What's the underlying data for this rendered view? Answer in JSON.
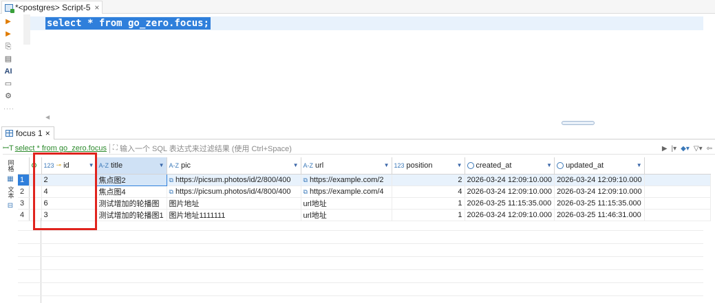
{
  "editor": {
    "tab_title": "*<postgres> Script-5",
    "close": "×",
    "sql": "select * from go_zero.focus;"
  },
  "results": {
    "tab_title": "focus 1",
    "close": "×",
    "filter_query": "select * from go_zero.focus",
    "filter_placeholder": "输入一个 SQL 表达式来过滤结果 (使用 Ctrl+Space)",
    "side_labels": [
      "网格",
      "文本"
    ]
  },
  "columns": [
    {
      "type": "123",
      "name": "id",
      "key": true
    },
    {
      "type": "A-Z",
      "name": "title"
    },
    {
      "type": "A-Z",
      "name": "pic"
    },
    {
      "type": "A-Z",
      "name": "url"
    },
    {
      "type": "123",
      "name": "position"
    },
    {
      "type": "clock",
      "name": "created_at"
    },
    {
      "type": "clock",
      "name": "updated_at"
    }
  ],
  "rows": [
    {
      "rn": "1",
      "id": "2",
      "title": "焦点图2",
      "pic": "https://picsum.photos/id/2/800/400",
      "url": "https://example.com/2",
      "position": "2",
      "created_at": "2026-03-24 12:09:10.000",
      "updated_at": "2026-03-24 12:09:10.000"
    },
    {
      "rn": "2",
      "id": "4",
      "title": "焦点图4",
      "pic": "https://picsum.photos/id/4/800/400",
      "url": "https://example.com/4",
      "position": "4",
      "created_at": "2026-03-24 12:09:10.000",
      "updated_at": "2026-03-24 12:09:10.000"
    },
    {
      "rn": "3",
      "id": "6",
      "title": "测试增加的轮播图",
      "pic": "图片地址",
      "url": "url地址",
      "position": "1",
      "created_at": "2026-03-25 11:15:35.000",
      "updated_at": "2026-03-25 11:15:35.000"
    },
    {
      "rn": "4",
      "id": "3",
      "title": "测试增加的轮播图1",
      "pic": "图片地址1111111",
      "url": "url地址",
      "position": "1",
      "created_at": "2026-03-24 12:09:10.000",
      "updated_at": "2026-03-25 11:46:31.000"
    }
  ],
  "colors": {
    "accent": "#2f7fdb",
    "highlight_box": "#e0231d",
    "filter_text": "#2c8a2c"
  }
}
